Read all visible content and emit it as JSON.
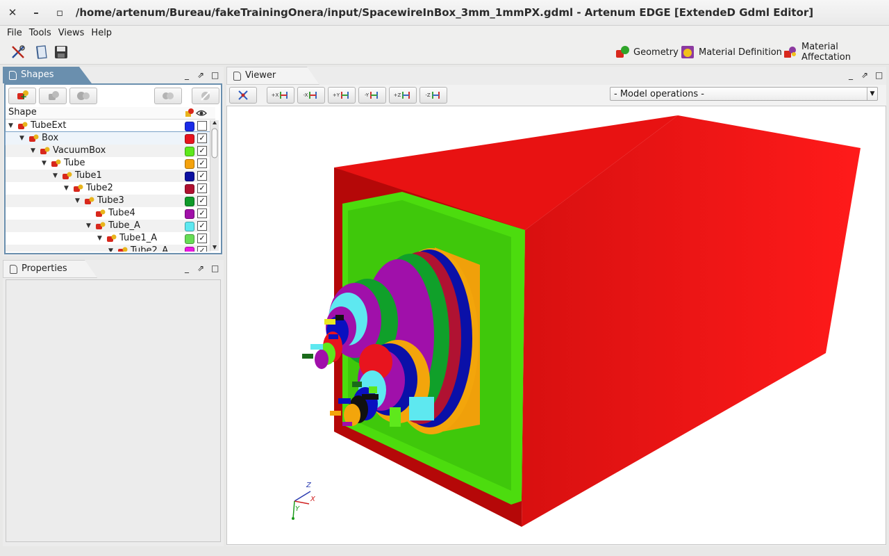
{
  "window": {
    "title": "/home/artenum/Bureau/fakeTrainingOnera/input/SpacewireInBox_3mm_1mmPX.gdml - Artenum EDGE [ExtendeD Gdml Editor]",
    "close_glyph": "✕",
    "minimize_glyph": "–",
    "maximize_glyph": "▫"
  },
  "menu": [
    "File",
    "Tools",
    "Views",
    "Help"
  ],
  "toolbar": {
    "icons": [
      "tools-icon",
      "book-icon",
      "save-icon"
    ]
  },
  "perspectives": [
    {
      "label": "Geometry",
      "icon": "geometry-icon"
    },
    {
      "label": "Material Definition",
      "icon": "material-definition-icon"
    },
    {
      "label": "Material Affectation",
      "icon": "material-affectation-icon"
    }
  ],
  "shapes_panel": {
    "title": "Shapes",
    "column_header": "Shape",
    "rows": [
      {
        "label": "TubeExt",
        "color": "#1a2be8",
        "checked": false
      },
      {
        "label": "Box",
        "color": "#e8141e",
        "checked": true
      },
      {
        "label": "VacuumBox",
        "color": "#5ee81c",
        "checked": true
      },
      {
        "label": "Tube",
        "color": "#f4a20e",
        "checked": true
      },
      {
        "label": "Tube1",
        "color": "#0a0fa0",
        "checked": true
      },
      {
        "label": "Tube2",
        "color": "#b01030",
        "checked": true
      },
      {
        "label": "Tube3",
        "color": "#0f9a2a",
        "checked": true
      },
      {
        "label": "Tube4",
        "color": "#a010a8",
        "checked": true
      },
      {
        "label": "Tube_A",
        "color": "#5ee8f0",
        "checked": true
      },
      {
        "label": "Tube1_A",
        "color": "#66dd55",
        "checked": true
      },
      {
        "label": "Tube2_A",
        "color": "#e818e0",
        "checked": true
      }
    ]
  },
  "properties_panel": {
    "title": "Properties"
  },
  "viewer": {
    "title": "Viewer",
    "view_buttons": [
      "+X",
      "-X",
      "+Y",
      "-Y",
      "+Z",
      "-Z"
    ],
    "model_operations": "- Model operations -",
    "axes": {
      "x": "X",
      "y": "Y",
      "z": "Z"
    }
  },
  "check_glyph": "✓",
  "tree_expanded_glyph": "▼",
  "panel_controls": {
    "minimize": "_",
    "float": "⇗",
    "maximize": "□"
  }
}
